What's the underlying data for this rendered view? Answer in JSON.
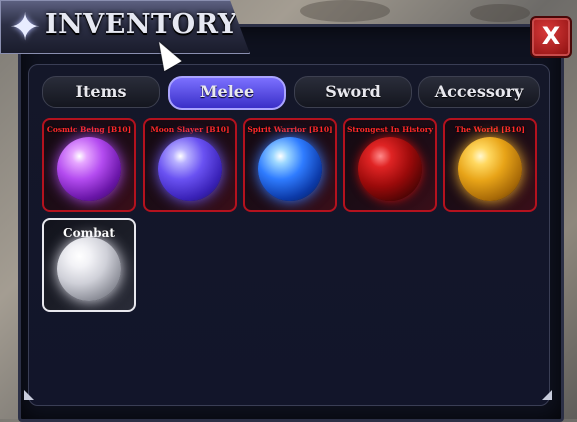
{
  "title": "INVENTORY",
  "close_label": "X",
  "tabs": [
    {
      "label": "Items",
      "active": false
    },
    {
      "label": "Melee",
      "active": true
    },
    {
      "label": "Sword",
      "active": false
    },
    {
      "label": "Accessory",
      "active": false
    }
  ],
  "items": [
    {
      "name": "Cosmic Being [B10]",
      "orb": "purple"
    },
    {
      "name": "Moon Slayer [B10]",
      "orb": "indigo"
    },
    {
      "name": "Spirit Warrior [B10]",
      "orb": "blue"
    },
    {
      "name": "Strongest In History",
      "orb": "red"
    },
    {
      "name": "The World [B10]",
      "orb": "gold"
    },
    {
      "name": "Combat",
      "orb": "white",
      "selected": true
    }
  ],
  "icons": {
    "title": "four-point-star-icon",
    "close": "close-icon",
    "cursor": "mouse-pointer-icon"
  },
  "colors": {
    "panel_bg": "#0f1220",
    "active_tab": "#5a4ff0",
    "item_border": "#b4121e",
    "item_name": "#ff2a2a",
    "selected_border": "#e8e8ee",
    "close_button": "#c11e1e"
  }
}
